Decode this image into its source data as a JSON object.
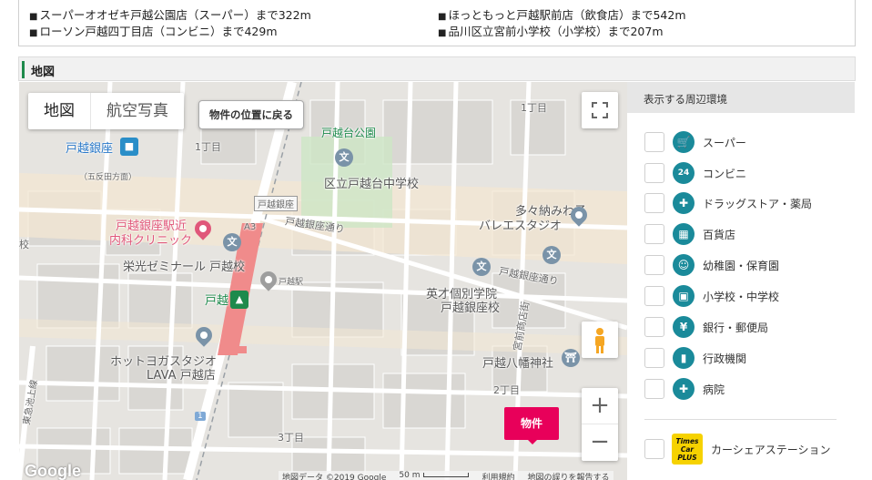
{
  "nearby": {
    "items": [
      "スーパーオオゼキ戸越公園店（スーパー）まで322m",
      "ほっともっと戸越駅前店（飲食店）まで542m",
      "ローソン戸越四丁目店（コンビニ）まで429m",
      "品川区立宮前小学校（小学校）まで207m"
    ]
  },
  "section": {
    "title": "地図"
  },
  "map": {
    "type_map": "地図",
    "type_satellite": "航空写真",
    "back_button": "物件の位置に戻る",
    "property_marker": "物件",
    "google_logo": "Google",
    "attribution": {
      "data": "地図データ ©2019 Google",
      "scale": "50 m",
      "terms": "利用規約",
      "report": "地図の誤りを報告する"
    },
    "labels": {
      "togoshi_ginza_station": "戸越銀座",
      "itchome_nw": "1丁目",
      "gotanda_direction": "（五反田方面）",
      "togoshidai_park": "戸越台公園",
      "togoshidai_jhs": "区立戸越台中学校",
      "itchome_ne": "1丁目",
      "tanami_ballet_1": "多々納みわ子",
      "tanami_ballet_2": "バレエスタジオ",
      "togoshi_ginza_sign": "戸越銀座",
      "a3": "A3",
      "ginza_street_w": "戸越銀座通り",
      "ginza_street_e": "戸越銀座通り",
      "clinic_1": "戸越銀座駅近",
      "clinic_2": "内科クリニック",
      "school_w": "校",
      "eiko_seminar": "栄光ゼミナール 戸越校",
      "togoshi_station_small": "戸越駅",
      "togoshi_station": "戸越",
      "eisai_1": "英才個別学院",
      "eisai_2": "戸越銀座校",
      "miyamae_street": "宮前商店街",
      "hot_yoga_1": "ホットヨガスタジオ",
      "hot_yoga_2": "LAVA 戸越店",
      "hachiman_shrine": "戸越八幡神社",
      "nichome": "2丁目",
      "sanchome": "3丁目",
      "route_1": "1",
      "ikegami_line": "東急池上線"
    }
  },
  "side": {
    "heading": "表示する周辺環境",
    "items": [
      {
        "label": "スーパー",
        "icon": "cart-icon",
        "glyph": "🛒"
      },
      {
        "label": "コンビニ",
        "icon": "convenience-store-icon",
        "glyph": "24"
      },
      {
        "label": "ドラッグストア・薬局",
        "icon": "pill-icon",
        "glyph": "✚"
      },
      {
        "label": "百貨店",
        "icon": "department-store-icon",
        "glyph": "▦"
      },
      {
        "label": "幼稚園・保育園",
        "icon": "kindergarten-icon",
        "glyph": "☺"
      },
      {
        "label": "小学校・中学校",
        "icon": "school-icon",
        "glyph": "▣"
      },
      {
        "label": "銀行・郵便局",
        "icon": "bank-icon",
        "glyph": "¥"
      },
      {
        "label": "行政機関",
        "icon": "government-icon",
        "glyph": "▮"
      },
      {
        "label": "病院",
        "icon": "hospital-icon",
        "glyph": "✚"
      }
    ],
    "carshare": {
      "label": "カーシェアステーション",
      "icon_text": "Times Car PLUS"
    }
  },
  "colors": {
    "accent_green": "#1e8a4c",
    "property_pink": "#e8005a",
    "env_icon_teal": "#1a8a9a",
    "times_yellow": "#f6d200"
  }
}
